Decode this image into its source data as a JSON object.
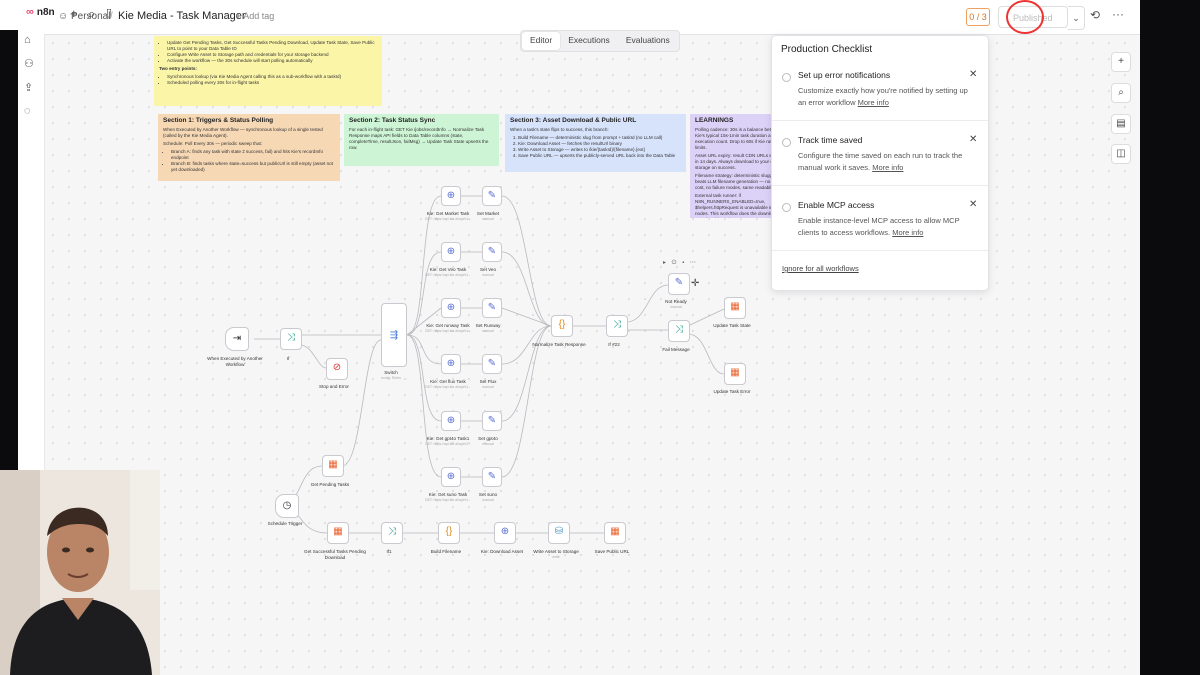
{
  "topbar": {
    "logo": "n8n",
    "breadcrumb_personal": "Personal",
    "separator": "/",
    "workflow_title": "Kie Media - Task Manager",
    "add_tag": "+ Add tag",
    "counter": "0 / 3",
    "publish_label": "Published"
  },
  "tabs": [
    "Editor",
    "Executions",
    "Evaluations"
  ],
  "stickies": {
    "top_note": {
      "lines": [
        "Update Get Pending Tasks, Get Successful Tasks Pending Download, Update Task State, Save Public URL to point to your Data Table ID",
        "Configure Write Asset to Storage path and credentials for your storage backend",
        "Activate the workflow — the 30s schedule will start polling automatically"
      ],
      "subheading": "Two entry points:",
      "bullets": [
        "Synchronous lookup (via Kie Media Agent calling this as a sub-workflow with a taskId)",
        "Scheduled polling every 30s for in-flight tasks"
      ]
    },
    "section1": {
      "title": "Section 1: Triggers & Status Polling",
      "p1": "When Executed by Another Workflow — synchronous lookup of a single tested (called by the Kie Media Agent).",
      "p2": "Schedule: Poll Every 30s — periodic sweep that:",
      "bullets": [
        "Branch A: finds any task with state ≠ success, fail) and hits Kie's recordInfo endpoint",
        "Branch B: finds tasks where state=success but publicUrl is still empty (asset not yet downloaded)"
      ]
    },
    "section2": {
      "title": "Section 2: Task Status Sync",
      "p1": "For each in-flight task: GET Kie /jobs/recordInfo → Normalize Task Response maps API fields to Data Table columns (state, completeTime, resultJson, failMsg) → Update Task State upserts the row."
    },
    "section3": {
      "title": "Section 3: Asset Download & Public URL",
      "p1": "When a task's state flips to success, this branch:",
      "items": [
        "Build Filename — deterministic slug from prompt + taskId (no LLM call)",
        "Kie: Download Asset — fetches the resultUrl binary",
        "Write Asset to Storage — writes to /kie/{taskId}/{filename}.{ext}",
        "Save Public URL — upserts the publicly-served URL back into the Data Table"
      ]
    },
    "learnings": {
      "title": "LEARNINGS",
      "p1": "Polling cadence: 30s is a balance between Kie's typical 15s-1min task duration and execution count. Drop to 60s if Kie rate-limits.",
      "p2": "Asset URL expiry: result CDN URLs expire in 14 days. Always download to your own storage on success.",
      "p3": "Filename strategy: deterministic slugging beats LLM filename generation — no API cost, no failure modes, same readability.",
      "p4": "External task runner: if N8N_RUNNERS_ENABLED=true, $helpers.httpRequest is unavailable in Code nodes. This workflow does the download in completed by using HTTP Request nodes for all HTTP calls."
    }
  },
  "nodes": [
    {
      "id": "exec_trigger",
      "label": "When Executed by Another Workflow",
      "sub": "",
      "icon": "arrow-in-icon"
    },
    {
      "id": "if1",
      "label": "If",
      "sub": "",
      "icon": "branch-icon"
    },
    {
      "id": "stop_error",
      "label": "Stop and Error",
      "sub": "",
      "icon": "stop-icon"
    },
    {
      "id": "switch",
      "label": "Switch",
      "sub": "mode: Rules",
      "icon": "switch-icon"
    },
    {
      "id": "get_market",
      "label": "Kie: Get Market Task",
      "sub": "GET: https://api.kie.ai/api/v1...",
      "icon": "globe-icon"
    },
    {
      "id": "set_market",
      "label": "Set Market",
      "sub": "manual",
      "icon": "edit-icon"
    },
    {
      "id": "get_veo",
      "label": "Kie: Get Veo Task",
      "sub": "GET: https://api.kie.ai/api/v1...",
      "icon": "globe-icon"
    },
    {
      "id": "set_veo",
      "label": "Set Veo",
      "sub": "manual",
      "icon": "edit-icon"
    },
    {
      "id": "get_runway",
      "label": "Kie: Get runway Task",
      "sub": "GET: https://api.kie.ai/api/v1...",
      "icon": "globe-icon"
    },
    {
      "id": "set_runway",
      "label": "Set Runway",
      "sub": "manual",
      "icon": "edit-icon"
    },
    {
      "id": "get_flux",
      "label": "Kie: Get flux Task",
      "sub": "GET: https://api.kie.ai/api/v1...",
      "icon": "globe-icon"
    },
    {
      "id": "set_flux",
      "label": "Set Flux",
      "sub": "manual",
      "icon": "edit-icon"
    },
    {
      "id": "get_gpt4o",
      "label": "Kie: Get gpt4o Task1",
      "sub": "GET: https://api.kie.ai/api/v1...",
      "icon": "globe-icon"
    },
    {
      "id": "set_gpt4o",
      "label": "Set gpt4o",
      "sub": "manual",
      "icon": "edit-icon"
    },
    {
      "id": "get_suno",
      "label": "Kie: Get suno Task",
      "sub": "GET: https://api.kie.ai/api/v1...",
      "icon": "globe-icon"
    },
    {
      "id": "set_suno",
      "label": "Set suno",
      "sub": "manual",
      "icon": "edit-icon"
    },
    {
      "id": "normalize",
      "label": "Normalize Task Response",
      "sub": "",
      "icon": "code-icon"
    },
    {
      "id": "if2",
      "label": "If #22",
      "sub": "",
      "icon": "branch-icon"
    },
    {
      "id": "not_ready",
      "label": "Not Ready",
      "sub": "manual",
      "icon": "edit-icon"
    },
    {
      "id": "fail_message",
      "label": "Fail Message",
      "sub": "",
      "icon": "branch-icon"
    },
    {
      "id": "update_state",
      "label": "Update Task State",
      "sub": "",
      "icon": "table-icon"
    },
    {
      "id": "update_error",
      "label": "Update Task Error",
      "sub": "",
      "icon": "table-icon"
    },
    {
      "id": "get_pending",
      "label": "Get Pending Tasks",
      "sub": "",
      "icon": "table-icon"
    },
    {
      "id": "schedule",
      "label": "Schedule Trigger",
      "sub": "",
      "icon": "clock-icon"
    },
    {
      "id": "get_success",
      "label": "Get Successful Tasks Pending Download",
      "sub": "",
      "icon": "table-icon"
    },
    {
      "id": "if3",
      "label": "If1",
      "sub": "",
      "icon": "branch-icon"
    },
    {
      "id": "build_filename",
      "label": "Build Filename",
      "sub": "",
      "icon": "code-icon"
    },
    {
      "id": "download",
      "label": "Kie: Download Asset",
      "sub": "",
      "icon": "globe-icon"
    },
    {
      "id": "write_storage",
      "label": "Write Asset to Storage",
      "sub": "write",
      "icon": "storage-icon"
    },
    {
      "id": "save_url",
      "label": "Save Public URL",
      "sub": "",
      "icon": "table-icon"
    }
  ],
  "checklist": {
    "title": "Production Checklist",
    "items": [
      {
        "title": "Set up error notifications",
        "desc": "Customize exactly how you're notified by setting up an error workflow",
        "link": "More info"
      },
      {
        "title": "Track time saved",
        "desc": "Configure the time saved on each run to track the manual work it saves.",
        "link": "More info"
      },
      {
        "title": "Enable MCP access",
        "desc": "Enable instance-level MCP access to allow MCP clients to access workflows.",
        "link": "More info"
      }
    ],
    "ignore_link": "Ignore for all workflows"
  },
  "right_toolbar": [
    "plus-icon",
    "search-icon",
    "note-icon",
    "panel-icon"
  ],
  "colors": {
    "accent": "#ea4b71",
    "sticky_yellow": "#fbf5a8",
    "sticky_orange": "#f6d8b5",
    "sticky_green": "#cdf4d4",
    "sticky_blue": "#d7e3fb",
    "sticky_purple": "#dcd2f8",
    "publish_ring": "#e33333",
    "counter_orange": "#d4731f"
  }
}
